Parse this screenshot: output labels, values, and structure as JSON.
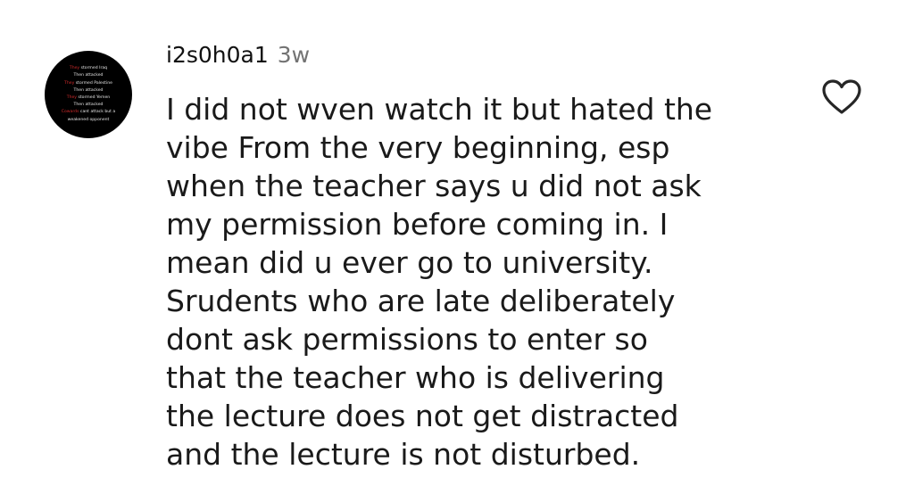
{
  "comment": {
    "username": "i2s0h0a1",
    "timestamp": "3w",
    "body_lines": [
      "I did not wven watch it but hated the",
      "vibe From the very beginning, esp",
      "when the teacher says u did not ask",
      "my permission before coming in. I",
      "mean did u ever go to university.",
      "Srudents who are late deliberately",
      "dont ask permissions to enter so",
      "that the teacher who is delivering",
      "the lecture does not get distracted",
      "and the lecture is not disturbed."
    ],
    "like_icon": "heart-outline-icon"
  },
  "avatar": {
    "lines": [
      {
        "highlight": "They",
        "text": " stormed Iraq"
      },
      {
        "highlight": "",
        "text": "Then attacked"
      },
      {
        "highlight": "They",
        "text": " stormed Palestine"
      },
      {
        "highlight": "",
        "text": "Then attacked"
      },
      {
        "highlight": "They",
        "text": " stormed Yemen"
      },
      {
        "highlight": "",
        "text": "Then attacked"
      },
      {
        "highlight": "Cowards",
        "text": " cant attack but a"
      },
      {
        "highlight": "",
        "text": "weakened opponent"
      }
    ],
    "background_color": "#000000",
    "highlight_color": "#d12b2b"
  },
  "colors": {
    "text": "#1a1a1a",
    "timestamp": "#737373",
    "icon_stroke": "#262626"
  }
}
